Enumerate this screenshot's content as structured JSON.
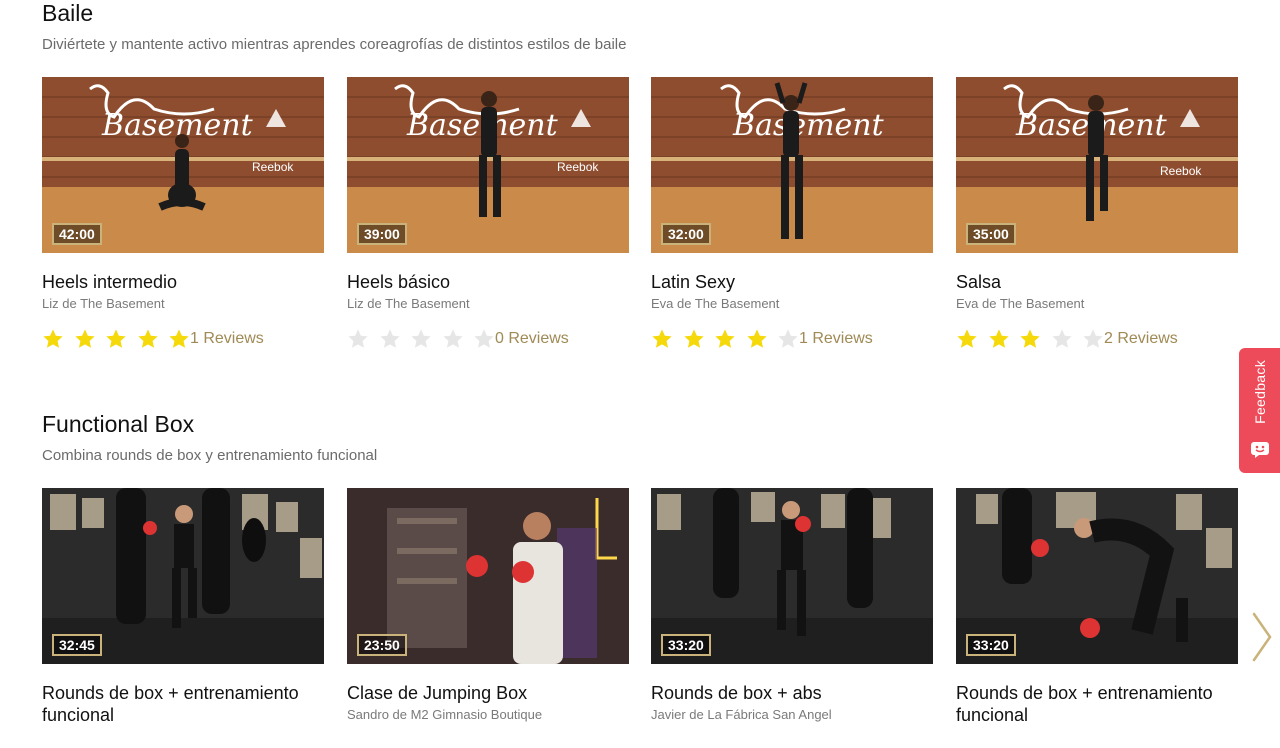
{
  "sections": [
    {
      "title": "Baile",
      "subtitle": "Diviértete y mantente activo mientras aprendes coreagrofías de distintos estilos de baile",
      "cards": [
        {
          "duration": "42:00",
          "title": "Heels intermedio",
          "instructor": "Liz de The Basement",
          "rating": 5,
          "reviews": "1 Reviews"
        },
        {
          "duration": "39:00",
          "title": "Heels básico",
          "instructor": "Liz de The Basement",
          "rating": 0,
          "reviews": "0 Reviews"
        },
        {
          "duration": "32:00",
          "title": "Latin Sexy",
          "instructor": "Eva de The Basement",
          "rating": 4,
          "reviews": "1 Reviews"
        },
        {
          "duration": "35:00",
          "title": "Salsa",
          "instructor": "Eva de The Basement",
          "rating": 3,
          "reviews": "2 Reviews"
        }
      ]
    },
    {
      "title": "Functional Box",
      "subtitle": "Combina rounds de box y entrenamiento funcional",
      "cards": [
        {
          "duration": "32:45",
          "title": "Rounds de box + entrenamiento funcional",
          "instructor": ""
        },
        {
          "duration": "23:50",
          "title": "Clase de Jumping Box",
          "instructor": "Sandro de M2 Gimnasio Boutique"
        },
        {
          "duration": "33:20",
          "title": "Rounds de box + abs",
          "instructor": "Javier de La Fábrica San Angel"
        },
        {
          "duration": "33:20",
          "title": "Rounds de box + entrenamiento funcional",
          "instructor": ""
        }
      ]
    }
  ],
  "feedback": {
    "label": "Feedback"
  },
  "icons": {
    "star": "star-icon",
    "next": "chevron-right-icon",
    "feedback": "chat-face-icon"
  },
  "colors": {
    "star_filled": "#f5d90a",
    "star_empty": "#e6e6e6",
    "reviews": "#a08a55",
    "feedback_bg": "#ee4b5a",
    "duration_border": "#c9b37a"
  }
}
